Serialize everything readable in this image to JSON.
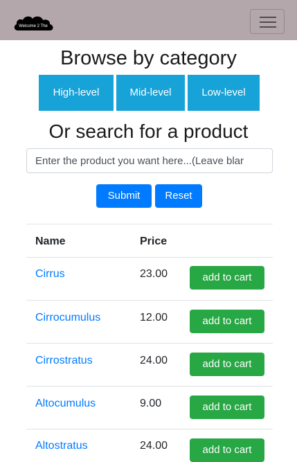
{
  "navbar": {
    "logo_text": "Welcome 2 The",
    "menu_icon": "hamburger-menu-icon"
  },
  "categories": {
    "heading": "Browse by category",
    "buttons": [
      "High-level",
      "Mid-level",
      "Low-level"
    ]
  },
  "search": {
    "heading": "Or search for a product",
    "placeholder": "Enter the product you want here...(Leave blar",
    "submit_label": "Submit",
    "reset_label": "Reset"
  },
  "table": {
    "headers": [
      "Name",
      "Price"
    ],
    "rows": [
      {
        "name": "Cirrus",
        "price": "23.00",
        "action": "add to cart"
      },
      {
        "name": "Cirrocumulus",
        "price": "12.00",
        "action": "add to cart"
      },
      {
        "name": "Cirrostratus",
        "price": "24.00",
        "action": "add to cart"
      },
      {
        "name": "Altocumulus",
        "price": "9.00",
        "action": "add to cart"
      },
      {
        "name": "Altostratus",
        "price": "24.00",
        "action": "add to cart"
      }
    ]
  },
  "colors": {
    "navbar": "#b4a7ab",
    "category_button": "#17a2d8",
    "primary": "#007bff",
    "success": "#28a745"
  }
}
